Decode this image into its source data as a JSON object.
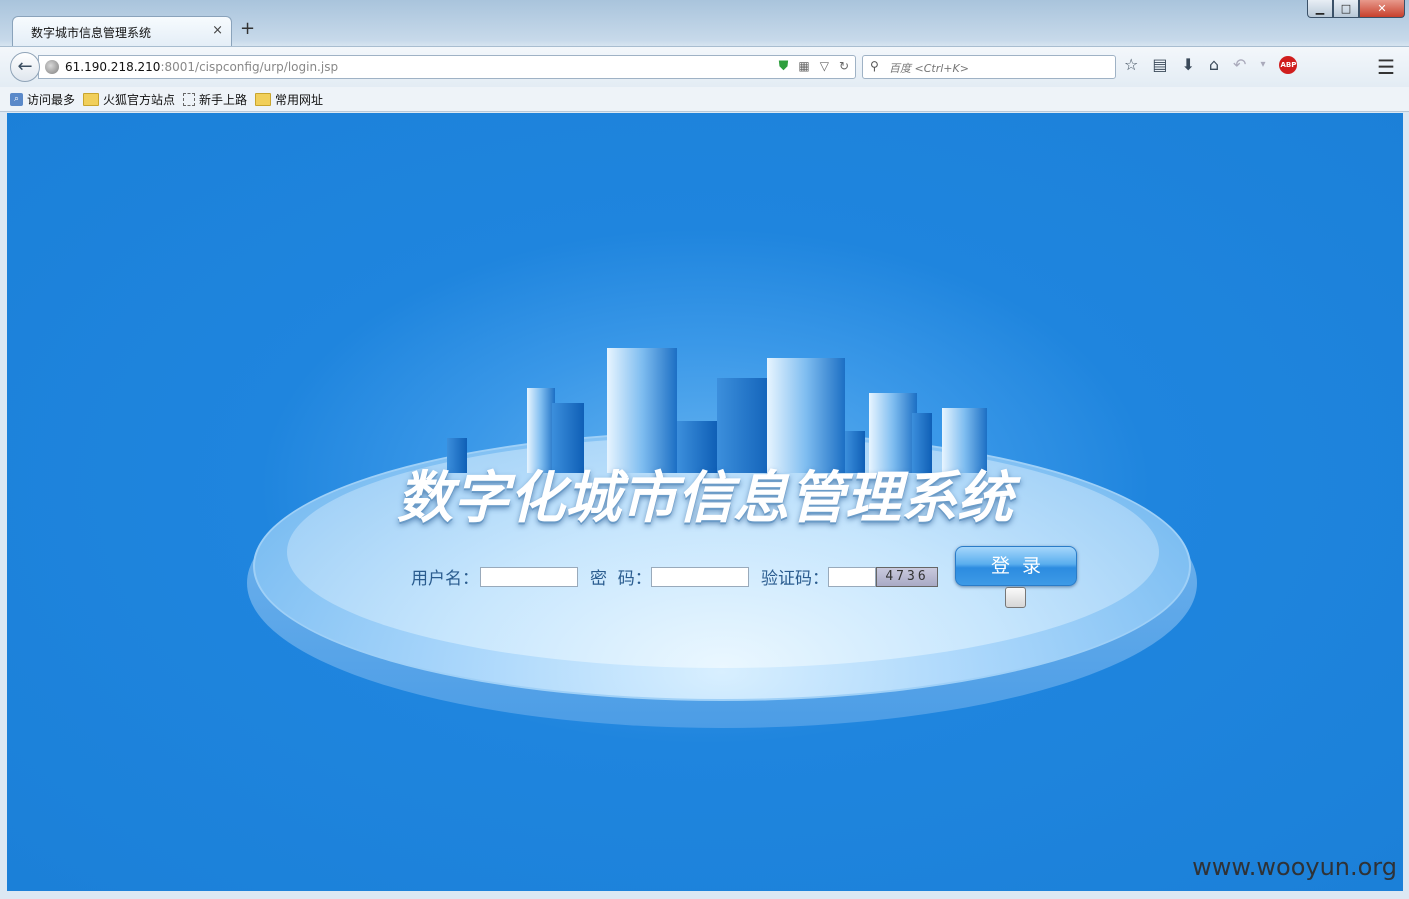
{
  "window": {
    "min": "▁",
    "max": "□",
    "close": "✕"
  },
  "tab": {
    "title": "数字城市信息管理系统",
    "close": "×",
    "new_tab": "+"
  },
  "navbar": {
    "url_host": "61.190.218.210",
    "url_path": ":8001/cispconfig/urp/login.jsp",
    "search_placeholder": "百度 <Ctrl+K>"
  },
  "bookmarks": [
    {
      "label": "访问最多",
      "icon": "most-visited-icon"
    },
    {
      "label": "火狐官方站点",
      "icon": "folder-icon"
    },
    {
      "label": "新手上路",
      "icon": "page-icon"
    },
    {
      "label": "常用网址",
      "icon": "folder-icon"
    }
  ],
  "page": {
    "title": "数字化城市信息管理系统",
    "username_label": "用户名：",
    "password_label": "密  码：",
    "captcha_label": "验证码：",
    "captcha_code": "4736",
    "login_button": "登录"
  },
  "watermark": "www.wooyun.org"
}
